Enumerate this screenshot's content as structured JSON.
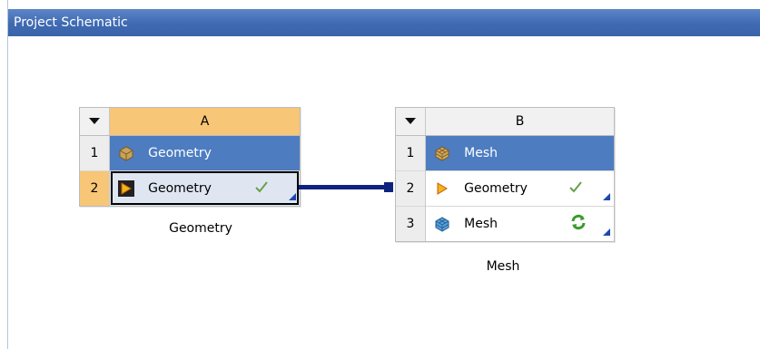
{
  "window": {
    "title": "Project Schematic"
  },
  "systemA": {
    "column_letter": "A",
    "rows": [
      {
        "num": "1",
        "label": "Geometry",
        "icon": "geometry-system-icon"
      },
      {
        "num": "2",
        "label": "Geometry",
        "icon": "geometry-cell-icon",
        "status": "check-icon"
      }
    ],
    "caption": "Geometry"
  },
  "systemB": {
    "column_letter": "B",
    "rows": [
      {
        "num": "1",
        "label": "Mesh",
        "icon": "mesh-system-icon"
      },
      {
        "num": "2",
        "label": "Geometry",
        "icon": "geometry-cell-icon",
        "status": "check-icon"
      },
      {
        "num": "3",
        "label": "Mesh",
        "icon": "mesh-cell-icon",
        "status": "refresh-icon"
      }
    ],
    "caption": "Mesh"
  },
  "colors": {
    "header": "#3f6ab2",
    "selected_row": "#4d7cc1",
    "connection": "#0f237e",
    "row_highlight": "#f7c676"
  }
}
